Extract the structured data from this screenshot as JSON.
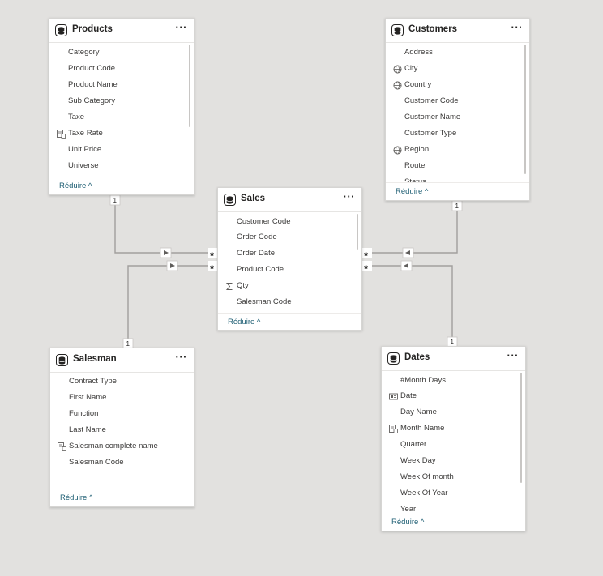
{
  "tables": [
    {
      "id": "products",
      "title": "Products",
      "more": "···",
      "fields": [
        {
          "label": "Category",
          "icon": ""
        },
        {
          "label": "Product Code",
          "icon": ""
        },
        {
          "label": "Product Name",
          "icon": ""
        },
        {
          "label": "Sub Category",
          "icon": ""
        },
        {
          "label": "Taxe",
          "icon": ""
        },
        {
          "label": "Taxe Rate",
          "icon": "measure-calc-icon"
        },
        {
          "label": "Unit Price",
          "icon": ""
        },
        {
          "label": "Universe",
          "icon": ""
        }
      ],
      "footer": "Réduire ^"
    },
    {
      "id": "customers",
      "title": "Customers",
      "more": "···",
      "fields": [
        {
          "label": "Address",
          "icon": ""
        },
        {
          "label": "City",
          "icon": "globe-icon"
        },
        {
          "label": "Country",
          "icon": "globe-icon"
        },
        {
          "label": "Customer Code",
          "icon": ""
        },
        {
          "label": "Customer Name",
          "icon": ""
        },
        {
          "label": "Customer Type",
          "icon": ""
        },
        {
          "label": "Region",
          "icon": "globe-icon"
        },
        {
          "label": "Route",
          "icon": ""
        },
        {
          "label": "Status",
          "icon": ""
        }
      ],
      "footer": "Réduire ^"
    },
    {
      "id": "sales",
      "title": "Sales",
      "more": "···",
      "fields": [
        {
          "label": "Customer Code",
          "icon": ""
        },
        {
          "label": "Order Code",
          "icon": ""
        },
        {
          "label": "Order Date",
          "icon": ""
        },
        {
          "label": "Product Code",
          "icon": ""
        },
        {
          "label": "Qty",
          "icon": "sigma-icon"
        },
        {
          "label": "Salesman Code",
          "icon": ""
        }
      ],
      "footer": "Réduire ^"
    },
    {
      "id": "salesman",
      "title": "Salesman",
      "more": "···",
      "fields": [
        {
          "label": "Contract Type",
          "icon": ""
        },
        {
          "label": "First Name",
          "icon": ""
        },
        {
          "label": "Function",
          "icon": ""
        },
        {
          "label": "Last Name",
          "icon": ""
        },
        {
          "label": "Salesman complete name",
          "icon": "measure-calc-icon"
        },
        {
          "label": "Salesman Code",
          "icon": ""
        }
      ],
      "footer": "Réduire ^"
    },
    {
      "id": "dates",
      "title": "Dates",
      "more": "···",
      "fields": [
        {
          "label": "#Month Days",
          "icon": ""
        },
        {
          "label": "Date",
          "icon": "calendar-icon"
        },
        {
          "label": "Day Name",
          "icon": ""
        },
        {
          "label": "Month Name",
          "icon": "measure-calc-icon"
        },
        {
          "label": "Quarter",
          "icon": ""
        },
        {
          "label": "Week Day",
          "icon": ""
        },
        {
          "label": "Week Of month",
          "icon": ""
        },
        {
          "label": "Week Of Year",
          "icon": ""
        },
        {
          "label": "Year",
          "icon": ""
        }
      ],
      "footer": "Réduire ^"
    }
  ],
  "relationships": [
    {
      "from": "Products",
      "to": "Sales",
      "one_side": "1",
      "many_side": "*"
    },
    {
      "from": "Customers",
      "to": "Sales",
      "one_side": "1",
      "many_side": "*"
    },
    {
      "from": "Salesman",
      "to": "Sales",
      "one_side": "1",
      "many_side": "*"
    },
    {
      "from": "Dates",
      "to": "Sales",
      "one_side": "1",
      "many_side": "*"
    }
  ],
  "colors": {
    "canvas": "#e2e1df",
    "link": "#1f5f74",
    "line": "#a19f9d"
  }
}
